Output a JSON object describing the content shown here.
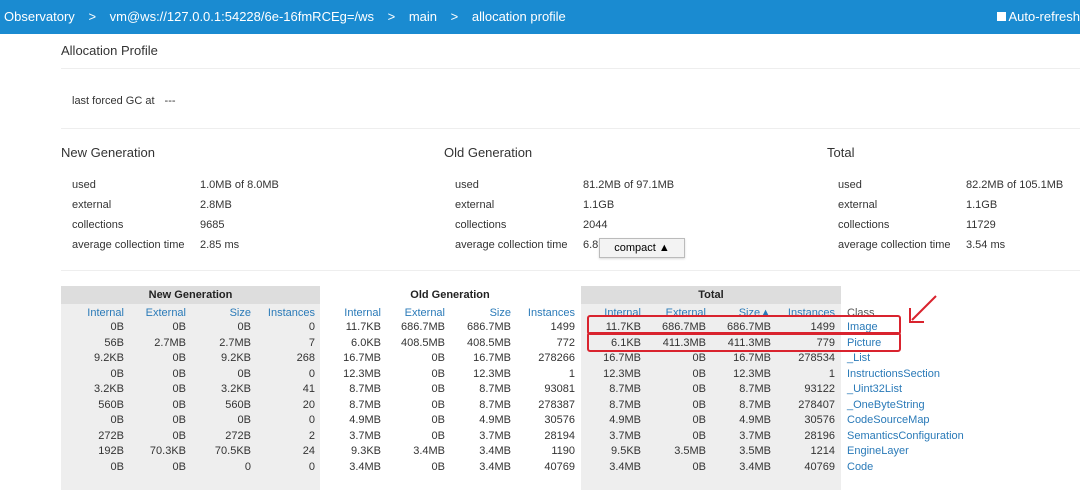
{
  "breadcrumbs": [
    "Observatory",
    "vm@ws://127.0.0.1:54228/6e-16fmRCEg=/ws",
    "main",
    "allocation profile"
  ],
  "breadcrumb_sep": ">",
  "auto_refresh_label": "Auto-refresh",
  "page_title": "Allocation Profile",
  "gc": {
    "label": "last forced GC at",
    "value": "---"
  },
  "sections": [
    {
      "title": "New Generation",
      "stats": [
        {
          "k": "used",
          "v": "1.0MB of 8.0MB"
        },
        {
          "k": "external",
          "v": "2.8MB"
        },
        {
          "k": "collections",
          "v": "9685"
        },
        {
          "k": "average collection time",
          "v": "2.85 ms"
        }
      ]
    },
    {
      "title": "Old Generation",
      "stats": [
        {
          "k": "used",
          "v": "81.2MB of 97.1MB"
        },
        {
          "k": "external",
          "v": "1.1GB"
        },
        {
          "k": "collections",
          "v": "2044"
        },
        {
          "k": "average collection time",
          "v": "6.8"
        }
      ]
    },
    {
      "title": "Total",
      "stats": [
        {
          "k": "used",
          "v": "82.2MB of 105.1MB"
        },
        {
          "k": "external",
          "v": "1.1GB"
        },
        {
          "k": "collections",
          "v": "11729"
        },
        {
          "k": "average collection time",
          "v": "3.54 ms"
        }
      ]
    }
  ],
  "compact_button": "compact ▲",
  "table": {
    "groups": [
      "New Generation",
      "Old Generation",
      "Total"
    ],
    "columns": [
      "Internal",
      "External",
      "Size",
      "Instances",
      "Internal",
      "External",
      "Size",
      "Instances",
      "Internal",
      "External",
      "Size▲",
      "Instances",
      "Class"
    ],
    "rows": [
      [
        "0B",
        "0B",
        "0B",
        "0",
        "11.7KB",
        "686.7MB",
        "686.7MB",
        "1499",
        "11.7KB",
        "686.7MB",
        "686.7MB",
        "1499",
        "Image"
      ],
      [
        "56B",
        "2.7MB",
        "2.7MB",
        "7",
        "6.0KB",
        "408.5MB",
        "408.5MB",
        "772",
        "6.1KB",
        "411.3MB",
        "411.3MB",
        "779",
        "Picture"
      ],
      [
        "9.2KB",
        "0B",
        "9.2KB",
        "268",
        "16.7MB",
        "0B",
        "16.7MB",
        "278266",
        "16.7MB",
        "0B",
        "16.7MB",
        "278534",
        "_List"
      ],
      [
        "0B",
        "0B",
        "0B",
        "0",
        "12.3MB",
        "0B",
        "12.3MB",
        "1",
        "12.3MB",
        "0B",
        "12.3MB",
        "1",
        "InstructionsSection"
      ],
      [
        "3.2KB",
        "0B",
        "3.2KB",
        "41",
        "8.7MB",
        "0B",
        "8.7MB",
        "93081",
        "8.7MB",
        "0B",
        "8.7MB",
        "93122",
        "_Uint32List"
      ],
      [
        "560B",
        "0B",
        "560B",
        "20",
        "8.7MB",
        "0B",
        "8.7MB",
        "278387",
        "8.7MB",
        "0B",
        "8.7MB",
        "278407",
        "_OneByteString"
      ],
      [
        "0B",
        "0B",
        "0B",
        "0",
        "4.9MB",
        "0B",
        "4.9MB",
        "30576",
        "4.9MB",
        "0B",
        "4.9MB",
        "30576",
        "CodeSourceMap"
      ],
      [
        "272B",
        "0B",
        "272B",
        "2",
        "3.7MB",
        "0B",
        "3.7MB",
        "28194",
        "3.7MB",
        "0B",
        "3.7MB",
        "28196",
        "SemanticsConfiguration"
      ],
      [
        "192B",
        "70.3KB",
        "70.5KB",
        "24",
        "9.3KB",
        "3.4MB",
        "3.4MB",
        "1190",
        "9.5KB",
        "3.5MB",
        "3.5MB",
        "1214",
        "EngineLayer"
      ],
      [
        "0B",
        "0B",
        "0",
        "0",
        "3.4MB",
        "0B",
        "3.4MB",
        "40769",
        "3.4MB",
        "0B",
        "3.4MB",
        "40769",
        "Code"
      ]
    ]
  },
  "colors": {
    "topbar": "#1a8bd1",
    "link": "#2a7ab8",
    "highlight": "#d9232e"
  }
}
